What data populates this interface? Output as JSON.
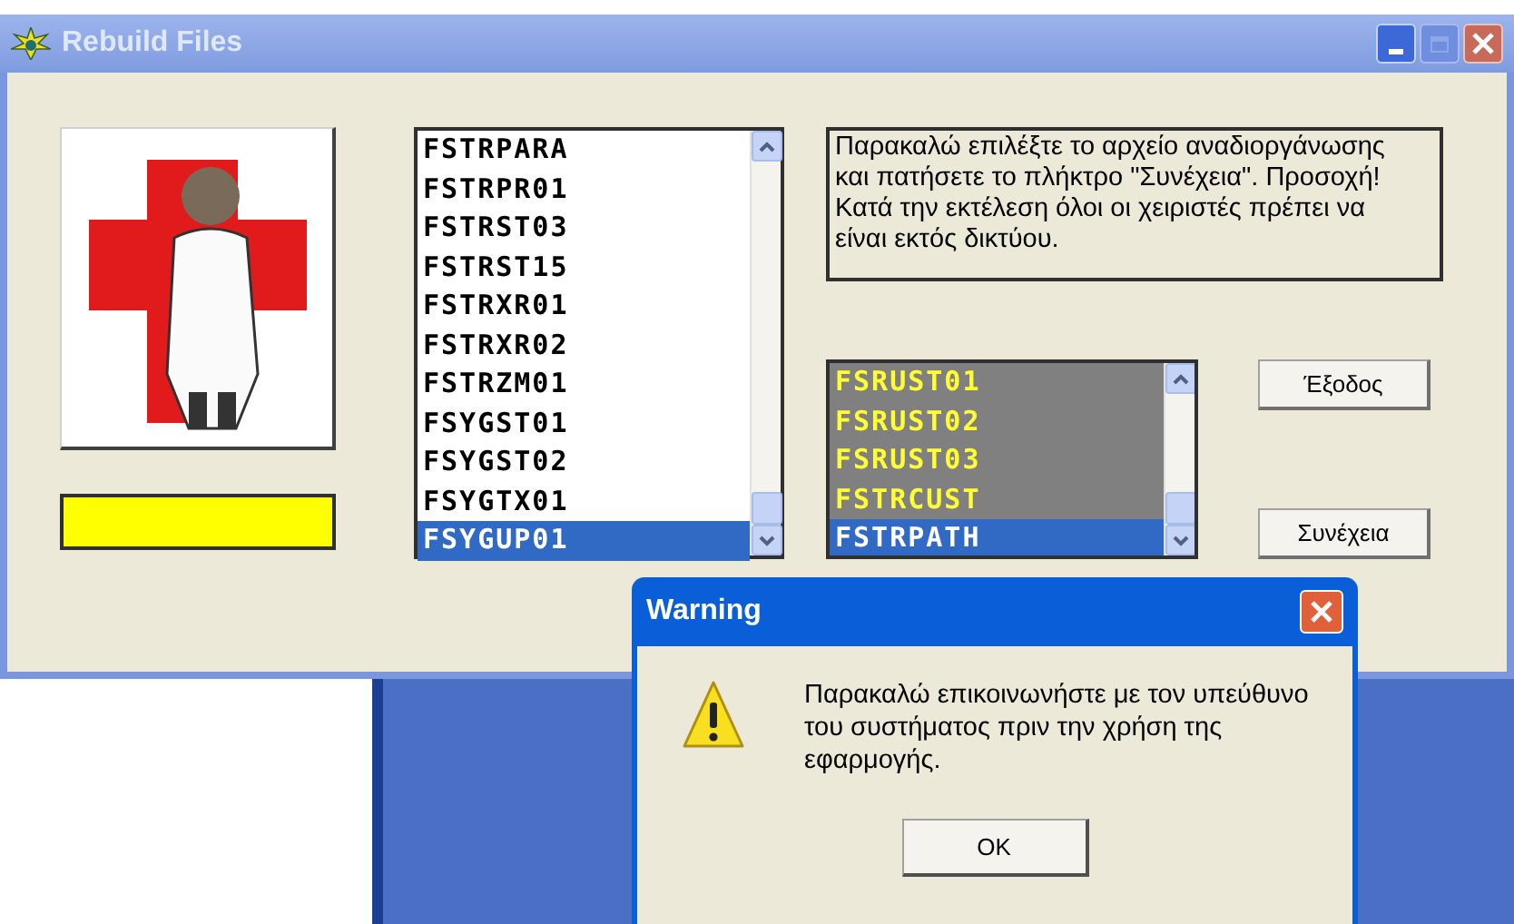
{
  "window": {
    "title": "Rebuild Files"
  },
  "files_list": {
    "items": [
      {
        "label": "FSTRPARA",
        "selected": false
      },
      {
        "label": "FSTRPR01",
        "selected": false
      },
      {
        "label": "FSTRST03",
        "selected": false
      },
      {
        "label": "FSTRST15",
        "selected": false
      },
      {
        "label": "FSTRXR01",
        "selected": false
      },
      {
        "label": "FSTRXR02",
        "selected": false
      },
      {
        "label": "FSTRZM01",
        "selected": false
      },
      {
        "label": "FSYGST01",
        "selected": false
      },
      {
        "label": "FSYGST02",
        "selected": false
      },
      {
        "label": "FSYGTX01",
        "selected": false
      },
      {
        "label": "FSYGUP01",
        "selected": true
      }
    ]
  },
  "instructions": "Παρακαλώ επιλέξτε το αρχείο αναδιοργάνωσης και πατήσετε το πλήκτρο \"Συνέχεια\". Προσοχή! Κατά την εκτέλεση όλοι οι χειριστές πρέπει να είναι εκτός δικτύου.",
  "selected_list": {
    "items": [
      {
        "label": "FSRUST01",
        "selected": false
      },
      {
        "label": "FSRUST02",
        "selected": false
      },
      {
        "label": "FSRUST03",
        "selected": false
      },
      {
        "label": "FSTRCUST",
        "selected": false
      },
      {
        "label": "FSTRPATH",
        "selected": true
      }
    ]
  },
  "buttons": [
    {
      "label": "Έξοδος"
    },
    {
      "label": "Συνέχεια"
    }
  ],
  "dialog": {
    "title": "Warning",
    "message": "Παρακαλώ επικοινωνήστε με τον υπεύθυνο του συστήματος πριν την χρήση της εφαρμογής.",
    "button": "OK"
  }
}
